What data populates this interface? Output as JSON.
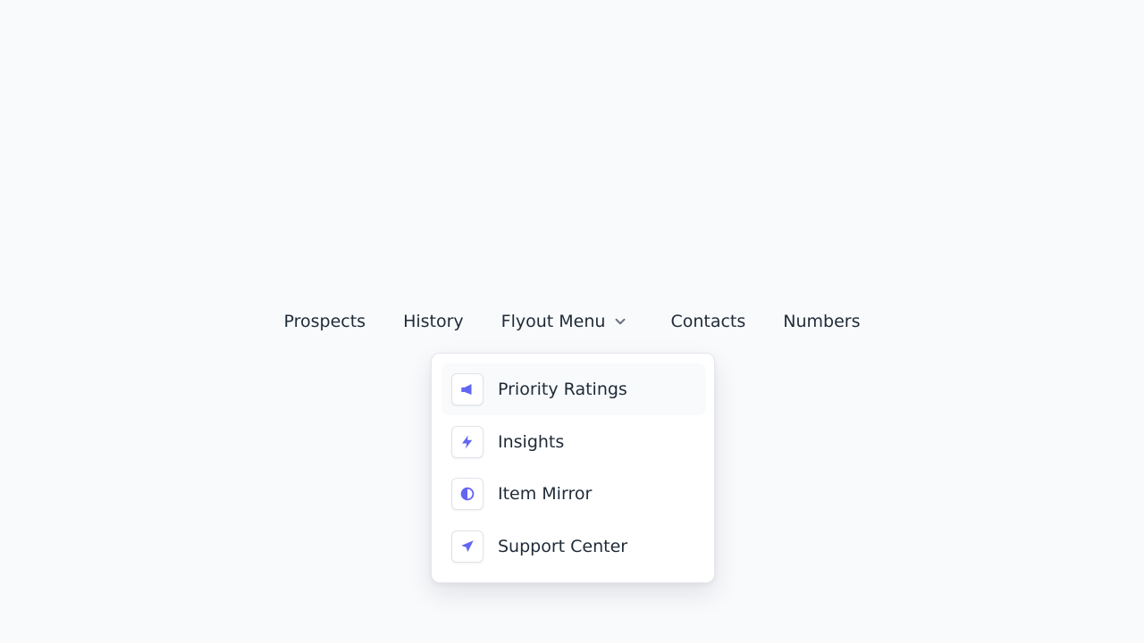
{
  "nav": {
    "items": [
      {
        "label": "Prospects"
      },
      {
        "label": "History"
      },
      {
        "label": "Flyout Menu"
      },
      {
        "label": "Contacts"
      },
      {
        "label": "Numbers"
      }
    ]
  },
  "flyout": {
    "items": [
      {
        "label": "Priority Ratings",
        "icon": "megaphone-icon",
        "state": "hovered"
      },
      {
        "label": "Insights",
        "icon": "lightning-bolt-icon"
      },
      {
        "label": "Item Mirror",
        "icon": "half-circle-contrast-icon"
      },
      {
        "label": "Support Center",
        "icon": "paper-plane-arrow-icon"
      }
    ]
  },
  "colors": {
    "background": "#f8fafc",
    "text": "#1f2a37",
    "accent": "#6366f1",
    "chevron": "#6b7280",
    "menu_border": "#e5e7eb"
  }
}
